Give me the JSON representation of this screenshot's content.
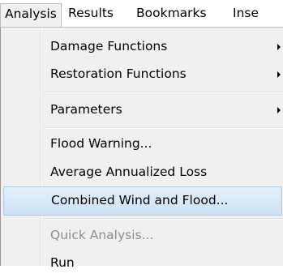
{
  "menubar": {
    "items": [
      {
        "label": "Analysis"
      },
      {
        "label": "Results"
      },
      {
        "label": "Bookmarks"
      },
      {
        "label": "Inse"
      }
    ]
  },
  "analysis_menu": {
    "items": [
      {
        "label": "Damage Functions",
        "submenu": true
      },
      {
        "label": "Restoration Functions",
        "submenu": true
      },
      {
        "label": "Parameters",
        "submenu": true
      },
      {
        "label": "Flood Warning..."
      },
      {
        "label": "Average Annualized Loss"
      },
      {
        "label": "Combined Wind and Flood...",
        "highlighted": true
      },
      {
        "label": "Quick Analysis...",
        "disabled": true
      },
      {
        "label": "Run"
      }
    ]
  },
  "colors": {
    "menu_background": "#f0f0f0",
    "highlight_background": "#cce2f6",
    "highlight_border": "#a8cce9",
    "disabled_text": "#8d8d8d"
  },
  "icons": {
    "submenu_arrow": "triangle-right"
  }
}
